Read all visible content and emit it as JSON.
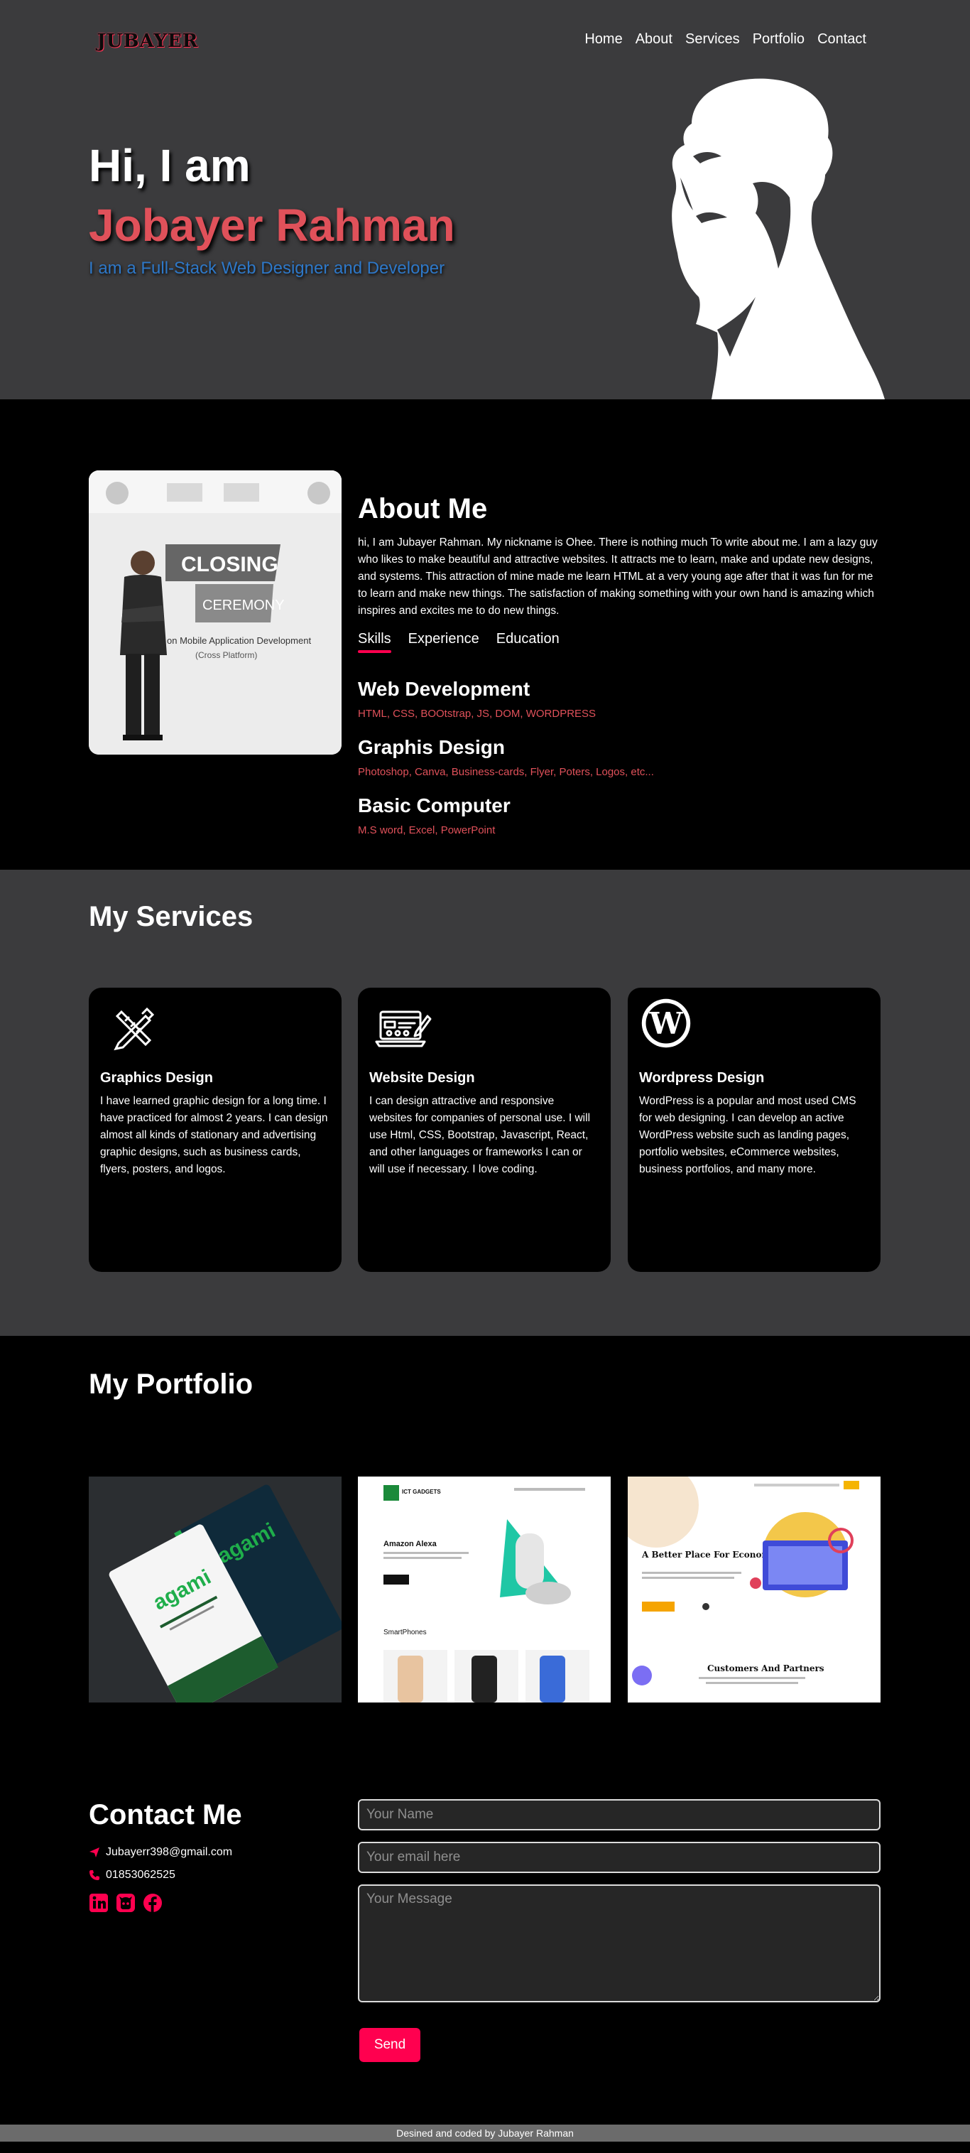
{
  "nav": {
    "logo": "JUBAYER",
    "links": [
      "Home",
      "About",
      "Services",
      "Portfolio",
      "Contact"
    ]
  },
  "hero": {
    "greeting": "Hi, I am",
    "name": "Jobayer Rahman",
    "tagline": "I am a Full-Stack Web Designer and Developer"
  },
  "about": {
    "title": "About Me",
    "text": "hi, I am Jubayer Rahman. My nickname is Ohee. There is nothing much To write about me. I am a lazy guy who likes to make beautiful and attractive websites. It attracts me to learn, make and update new designs, and systems. This attraction of mine made me learn HTML at a very young age after that it was fun for me to learn and make new things. The satisfaction of making something with your own hand is amazing which inspires and excites me to do new things.",
    "photo": {
      "banner_main": "CLOSING",
      "banner_sub": "CEREMONY",
      "banner_line1": "on Mobile Application Development",
      "banner_line2": "(Cross Platform)"
    },
    "tabs": [
      "Skills",
      "Experience",
      "Education"
    ],
    "active_tab": "Skills",
    "skills": [
      {
        "title": "Web Development",
        "desc": "HTML, CSS, BOOtstrap, JS, DOM, WORDPRESS"
      },
      {
        "title": "Graphis Design",
        "desc": "Photoshop, Canva, Business-cards, Flyer, Poters, Logos, etc..."
      },
      {
        "title": "Basic Computer",
        "desc": "M.S word, Excel, PowerPoint"
      }
    ]
  },
  "services": {
    "title": "My Services",
    "items": [
      {
        "icon": "pencil-ruler-icon",
        "title": "Graphics Design",
        "desc": "I have learned graphic design for a long time. I have practiced for almost 2 years. I can design almost all kinds of stationary and advertising graphic designs, such as business cards, flyers, posters, and logos."
      },
      {
        "icon": "website-design-icon",
        "title": "Website Design",
        "desc": "I can design attractive and responsive websites for companies of personal use. I will use Html, CSS, Bootstrap, Javascript, React, and other languages or frameworks I can or will use if necessary. I love coding."
      },
      {
        "icon": "wordpress-icon",
        "title": "Wordpress Design",
        "desc": "WordPress is a popular and most used CMS for web designing. I can develop an active WordPress website such as landing pages, portfolio websites, eCommerce websites, business portfolios, and many more."
      }
    ]
  },
  "portfolio": {
    "title": "My Portfolio",
    "works": [
      {
        "name": "business-card-mockup",
        "brand": "agami",
        "caption": ""
      },
      {
        "name": "ecommerce-site-mockup",
        "brand": "ICT GADGETS",
        "headline": "Amazon Alexa",
        "section": "SmartPhones"
      },
      {
        "name": "developer-site-mockup",
        "headline": "A Better Place For Economic Developer",
        "section": "Customers And Partners"
      }
    ]
  },
  "contact": {
    "title": "Contact Me",
    "email": "Jubayerr398@gmail.com",
    "phone": "01853062525",
    "name_placeholder": "Your Name",
    "email_placeholder": "Your email here",
    "message_placeholder": "Your Message",
    "send_label": "Send"
  },
  "footer": {
    "text": "Desined and coded by Jubayer Rahman"
  },
  "colors": {
    "accent": "#ff004f",
    "name": "#e0515a",
    "tagline": "#2e78c8",
    "hero_bg": "#3b3b3d"
  }
}
